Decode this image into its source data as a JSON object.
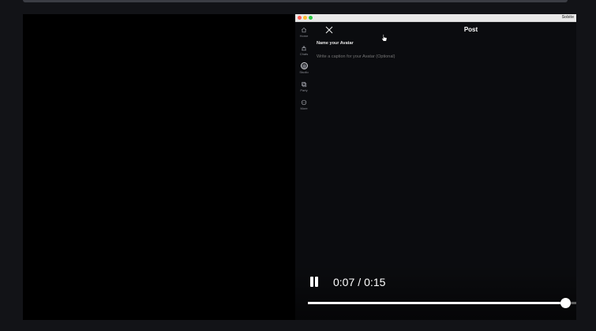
{
  "window": {
    "title": "Sobite"
  },
  "nav": {
    "items": [
      {
        "label": "Home",
        "icon": "home-icon"
      },
      {
        "label": "Chats",
        "icon": "chat-icon"
      },
      {
        "label": "Studio",
        "icon": "avatar-icon"
      },
      {
        "label": "Party",
        "icon": "party-icon"
      },
      {
        "label": "More",
        "icon": "more-icon"
      }
    ]
  },
  "post": {
    "title": "Post",
    "name_value": "Name your Avatar",
    "caption_placeholder": "Write a caption for your Avatar (Optional)"
  },
  "player": {
    "current_time": "0:07",
    "separator": "/",
    "duration": "0:15",
    "progress": 0.96
  },
  "colors": {
    "background": "#121317",
    "video": "#000000",
    "app_bg": "#0b0c0f",
    "text": "#ffffff"
  }
}
